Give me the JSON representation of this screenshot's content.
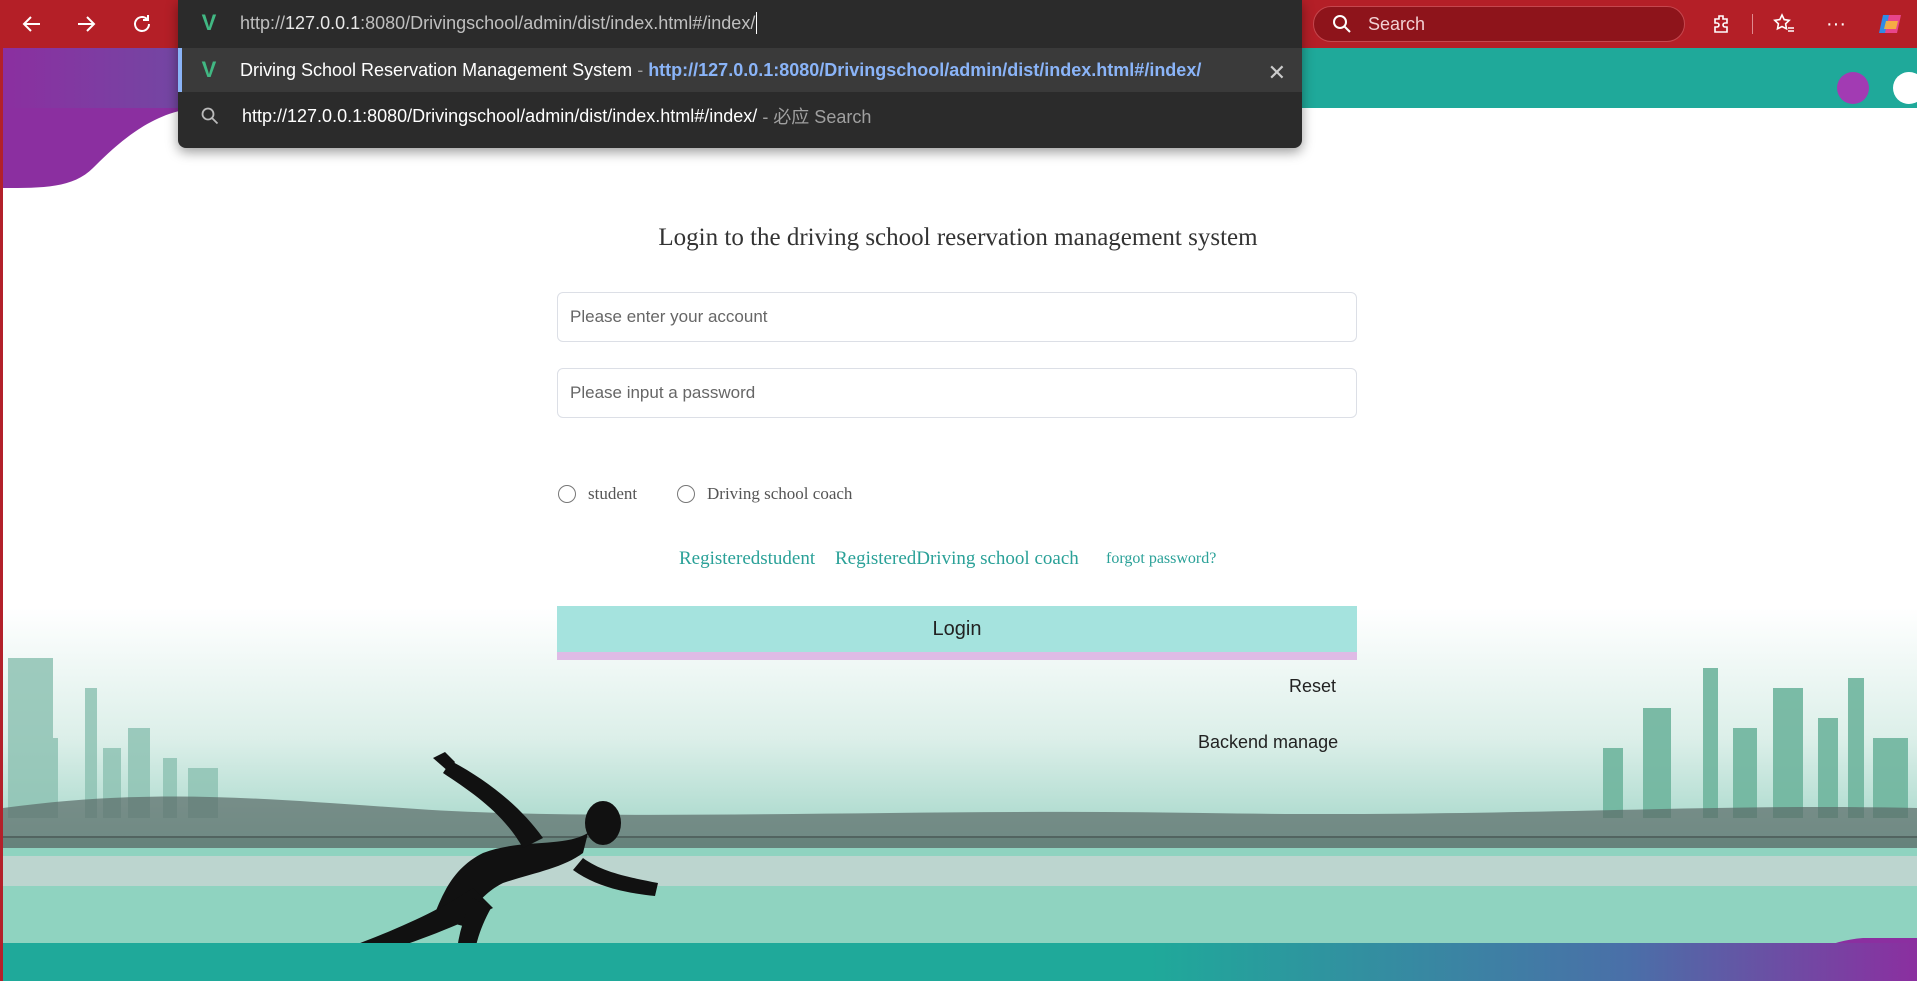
{
  "browser": {
    "address_typed_prefix": "http://",
    "address_typed_host": "127.0.0.1",
    "address_typed_rest": ":8080/Drivingschool/admin/dist/index.html#/index/",
    "search_placeholder": "Search"
  },
  "omnibox": {
    "suggestion_title": "Driving School Reservation Management System",
    "suggestion_dash": " - ",
    "suggestion_url": "http://127.0.0.1:8080/Drivingschool/admin/dist/index.html#/index/",
    "search_query": "http://127.0.0.1:8080/Drivingschool/admin/dist/index.html#/index/",
    "search_suffix": " - 必应 Search"
  },
  "login": {
    "title": "Login to the driving school reservation management system",
    "account_placeholder": "Please enter your account",
    "password_placeholder": "Please input a password",
    "roles": [
      "student",
      "Driving school coach"
    ],
    "register_student": "Registeredstudent",
    "register_coach": "RegisteredDriving school coach",
    "forgot": "forgot password?",
    "login_button": "Login",
    "reset": "Reset",
    "backend": "Backend manage"
  },
  "colors": {
    "browser_red": "#b41f27",
    "teal": "#1fa99a",
    "purple": "#8b2fa0",
    "login_button": "#a5e3de",
    "link": "#2aa198"
  }
}
